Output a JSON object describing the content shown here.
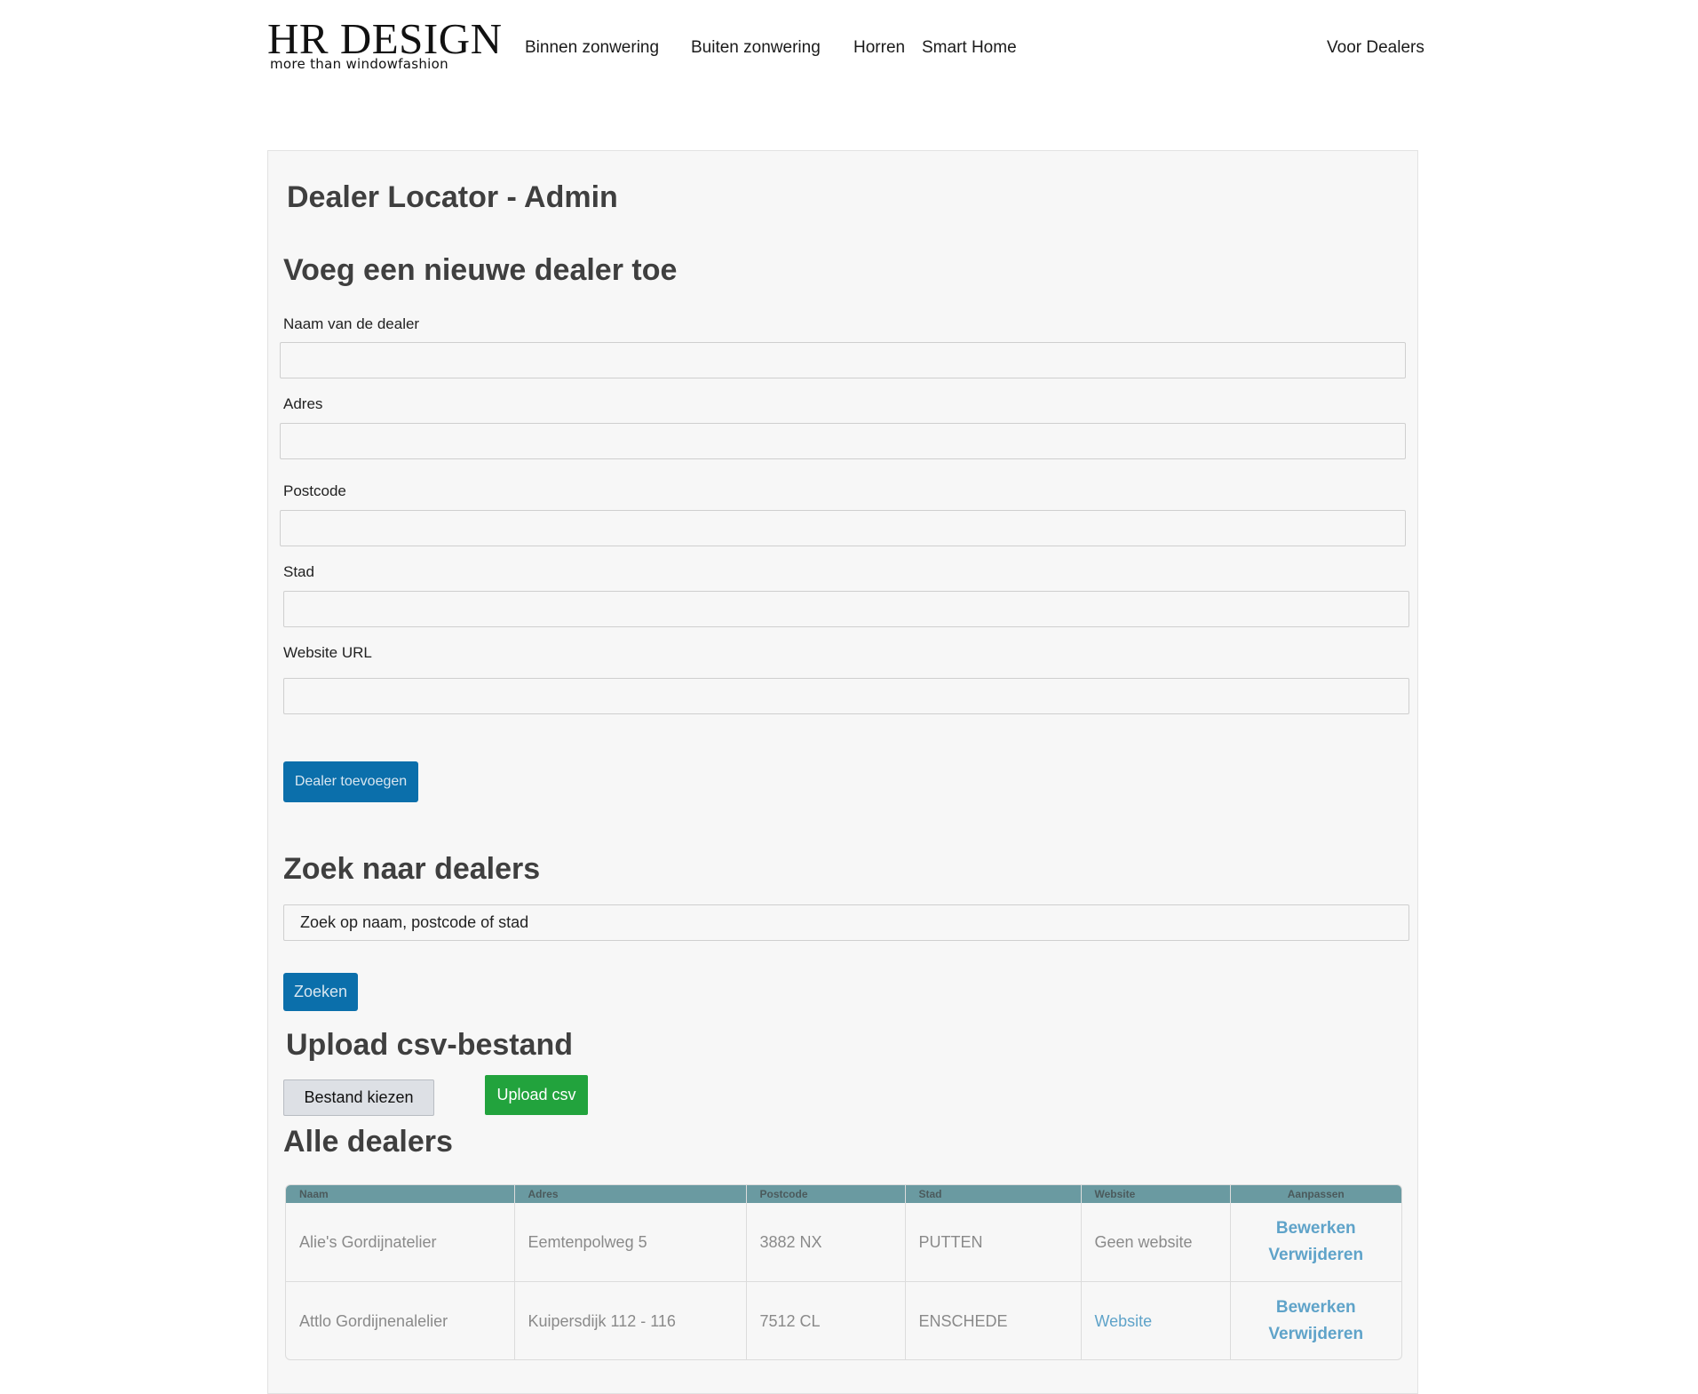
{
  "header": {
    "logo": {
      "title": "HR DESIGN",
      "tagline": "more than windowfashion"
    },
    "nav": [
      {
        "label": "Binnen zonwering"
      },
      {
        "label": "Buiten zonwering"
      },
      {
        "label": "Horren"
      },
      {
        "label": "Smart Home"
      },
      {
        "label": "Voor Dealers"
      }
    ]
  },
  "page": {
    "title": "Dealer Locator - Admin",
    "add_section": {
      "heading": "Voeg een nieuwe dealer toe",
      "fields": [
        {
          "label": "Naam van de dealer",
          "value": ""
        },
        {
          "label": "Adres",
          "value": ""
        },
        {
          "label": "Postcode",
          "value": ""
        },
        {
          "label": "Stad",
          "value": ""
        },
        {
          "label": "Website URL",
          "value": ""
        }
      ],
      "submit_label": "Dealer toevoegen"
    },
    "search_section": {
      "heading": "Zoek naar dealers",
      "placeholder": "Zoek op naam, postcode of stad",
      "button_label": "Zoeken"
    },
    "upload_section": {
      "heading": "Upload csv-bestand",
      "file_button_label": "Bestand kiezen",
      "upload_button_label": "Upload csv"
    },
    "dealers_section": {
      "heading": "Alle dealers",
      "columns": [
        "Naam",
        "Adres",
        "Postcode",
        "Stad",
        "Website",
        "Aanpassen"
      ],
      "rows": [
        {
          "naam": "Alie's Gordijnatelier",
          "adres": "Eemtenpolweg 5",
          "postcode": "3882 NX",
          "stad": "PUTTEN",
          "website": "Geen website",
          "website_is_link": false,
          "edit": "Bewerken",
          "delete": "Verwijderen"
        },
        {
          "naam": "Attlo Gordijnenalelier",
          "adres": "Kuipersdijk 112 - 116",
          "postcode": "7512 CL",
          "stad": "ENSCHEDE",
          "website": "Website",
          "website_is_link": true,
          "edit": "Bewerken",
          "delete": "Verwijderen"
        }
      ]
    }
  },
  "colors": {
    "primary_button": "#0b6fab",
    "upload_button": "#22a33d",
    "table_header": "#6a9aa1",
    "link": "#5fa3c9"
  }
}
